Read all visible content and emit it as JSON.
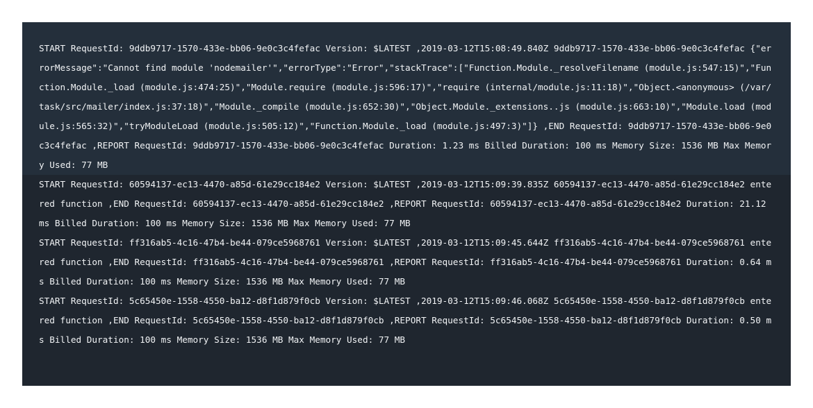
{
  "colors": {
    "page_background": "#ffffff",
    "panel_background": "#1f262f",
    "highlighted_entry_background": "#242f3b",
    "text": "#f1f3f5"
  },
  "log": {
    "entries": [
      "START RequestId: 9ddb9717-1570-433e-bb06-9e0c3c4fefac Version: $LATEST ,2019-03-12T15:08:49.840Z 9ddb9717-1570-433e-bb06-9e0c3c4fefac {\"errorMessage\":\"Cannot find module 'nodemailer'\",\"errorType\":\"Error\",\"stackTrace\":[\"Function.Module._resolveFilename (module.js:547:15)\",\"Function.Module._load (module.js:474:25)\",\"Module.require (module.js:596:17)\",\"require (internal/module.js:11:18)\",\"Object.<anonymous> (/var/task/src/mailer/index.js:37:18)\",\"Module._compile (module.js:652:30)\",\"Object.Module._extensions..js (module.js:663:10)\",\"Module.load (module.js:565:32)\",\"tryModuleLoad (module.js:505:12)\",\"Function.Module._load (module.js:497:3)\"]} ,END RequestId: 9ddb9717-1570-433e-bb06-9e0c3c4fefac ,REPORT RequestId: 9ddb9717-1570-433e-bb06-9e0c3c4fefac Duration: 1.23 ms Billed Duration: 100 ms Memory Size: 1536 MB Max Memory Used: 77 MB",
      "START RequestId: 60594137-ec13-4470-a85d-61e29cc184e2 Version: $LATEST ,2019-03-12T15:09:39.835Z 60594137-ec13-4470-a85d-61e29cc184e2 entered function ,END RequestId: 60594137-ec13-4470-a85d-61e29cc184e2 ,REPORT RequestId: 60594137-ec13-4470-a85d-61e29cc184e2 Duration: 21.12 ms Billed Duration: 100 ms Memory Size: 1536 MB Max Memory Used: 77 MB",
      "START RequestId: ff316ab5-4c16-47b4-be44-079ce5968761 Version: $LATEST ,2019-03-12T15:09:45.644Z ff316ab5-4c16-47b4-be44-079ce5968761 entered function ,END RequestId: ff316ab5-4c16-47b4-be44-079ce5968761 ,REPORT RequestId: ff316ab5-4c16-47b4-be44-079ce5968761 Duration: 0.64 ms Billed Duration: 100 ms Memory Size: 1536 MB Max Memory Used: 77 MB",
      "START RequestId: 5c65450e-1558-4550-ba12-d8f1d879f0cb Version: $LATEST ,2019-03-12T15:09:46.068Z 5c65450e-1558-4550-ba12-d8f1d879f0cb entered function ,END RequestId: 5c65450e-1558-4550-ba12-d8f1d879f0cb ,REPORT RequestId: 5c65450e-1558-4550-ba12-d8f1d879f0cb Duration: 0.50 ms Billed Duration: 100 ms Memory Size: 1536 MB Max Memory Used: 77 MB"
    ]
  }
}
